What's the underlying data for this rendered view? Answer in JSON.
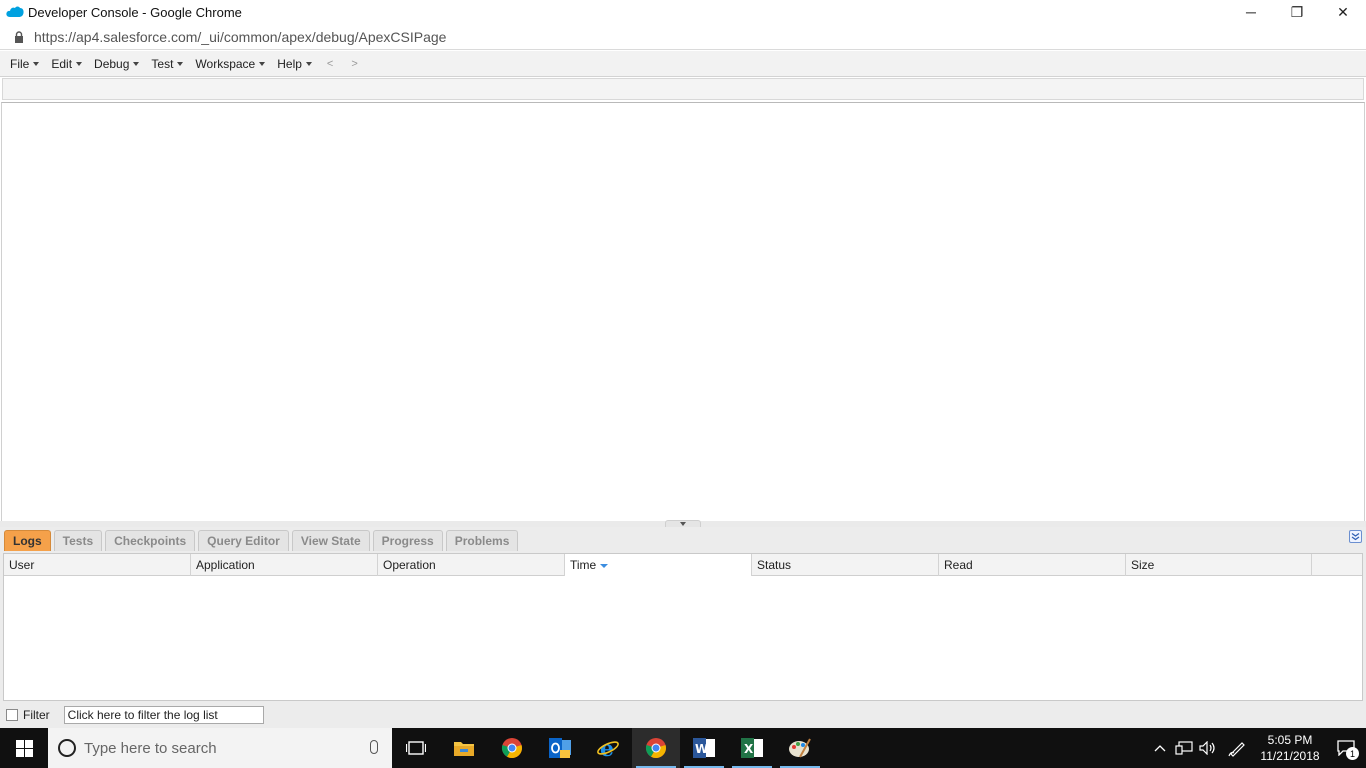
{
  "window": {
    "title": "Developer Console - Google Chrome",
    "url": "https://ap4.salesforce.com/_ui/common/apex/debug/ApexCSIPage",
    "controls": {
      "minimize": "─",
      "restore": "❐",
      "close": "✕"
    }
  },
  "menu": {
    "items": [
      "File",
      "Edit",
      "Debug",
      "Test",
      "Workspace",
      "Help"
    ],
    "back": "<",
    "forward": ">"
  },
  "panel": {
    "tabs": [
      "Logs",
      "Tests",
      "Checkpoints",
      "Query Editor",
      "View State",
      "Progress",
      "Problems"
    ],
    "active_tab": "Logs",
    "columns": [
      "User",
      "Application",
      "Operation",
      "Time",
      "Status",
      "Read",
      "Size"
    ],
    "sorted_column": "Time",
    "filter_label": "Filter",
    "filter_placeholder": "Click here to filter the log list"
  },
  "taskbar": {
    "search_placeholder": "Type here to search",
    "apps": [
      "task-view",
      "file-explorer",
      "chrome",
      "outlook",
      "internet-explorer",
      "chrome-active",
      "word",
      "excel",
      "paint"
    ],
    "time": "5:05 PM",
    "date": "11/21/2018",
    "notification_count": "1"
  },
  "colors": {
    "active_tab": "#f5a14a",
    "taskbar": "#101010",
    "salesforce_blue": "#00a1e0"
  }
}
